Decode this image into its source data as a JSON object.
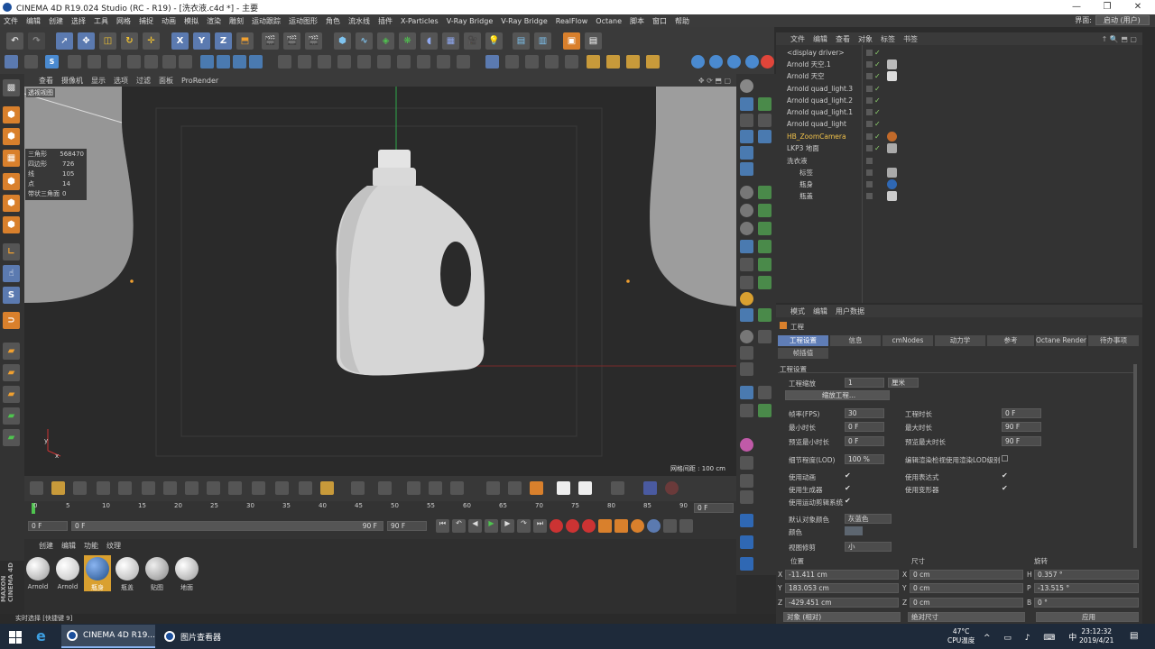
{
  "window": {
    "title": "CINEMA 4D R19.024 Studio (RC - R19) - [洗衣液.c4d *] - 主要"
  },
  "menubar": {
    "items": [
      "文件",
      "编辑",
      "创建",
      "选择",
      "工具",
      "网格",
      "捕捉",
      "动画",
      "模拟",
      "渲染",
      "雕刻",
      "运动跟踪",
      "运动图形",
      "角色",
      "流水线",
      "插件",
      "X-Particles",
      "V-Ray Bridge",
      "V-Ray Bridge",
      "RealFlow",
      "Octane",
      "脚本",
      "窗口",
      "帮助"
    ],
    "layout_label": "界面:",
    "layout_value": "启动 (用户)"
  },
  "viewport": {
    "menu": [
      "查看",
      "摄像机",
      "显示",
      "选项",
      "过滤",
      "面板",
      "ProRender"
    ],
    "name": "透视视图",
    "stats": [
      {
        "k": "三角形",
        "v": "568470"
      },
      {
        "k": "四边形",
        "v": "726"
      },
      {
        "k": "线",
        "v": "105"
      },
      {
        "k": "点",
        "v": "14"
      },
      {
        "k": "带状三角面",
        "v": "0"
      }
    ],
    "grid_label": "网格间距 : 100 cm"
  },
  "object_manager": {
    "menu": [
      "文件",
      "编辑",
      "查看",
      "对象",
      "标签",
      "书签"
    ],
    "objects": [
      {
        "name": "<display driver>",
        "color": "#cfcfcf"
      },
      {
        "name": "Arnold 天空.1",
        "color": "#cfcfcf"
      },
      {
        "name": "Arnold 天空",
        "color": "#cfcfcf"
      },
      {
        "name": "Arnold quad_light.3",
        "color": "#cfcfcf"
      },
      {
        "name": "Arnold quad_light.2",
        "color": "#cfcfcf"
      },
      {
        "name": "Arnold quad_light.1",
        "color": "#cfcfcf"
      },
      {
        "name": "Arnold quad_light",
        "color": "#cfcfcf"
      },
      {
        "name": "HB_ZoomCamera",
        "color": "#f0c14a"
      },
      {
        "name": "LKP3 地面",
        "color": "#cfcfcf"
      },
      {
        "name": "洗衣液",
        "color": "#cfcfcf"
      },
      {
        "name": "标签",
        "color": "#cfcfcf"
      },
      {
        "name": "瓶身",
        "color": "#cfcfcf"
      },
      {
        "name": "瓶盖",
        "color": "#cfcfcf"
      }
    ]
  },
  "attribute_manager": {
    "menu": [
      "模式",
      "编辑",
      "用户数据"
    ],
    "title": "工程",
    "tabs": [
      "工程设置",
      "信息",
      "cmNodes",
      "动力学",
      "参考",
      "Octane Render",
      "待办事项",
      "帧插值"
    ],
    "section": "工程设置",
    "fields": {
      "scale_label": "工程缩放",
      "scale_value": "1",
      "scale_unit": "厘米",
      "scale_button": "缩放工程...",
      "fps_label": "帧率(FPS)",
      "fps_value": "30",
      "project_time_label": "工程时长",
      "project_time_value": "0 F",
      "min_time_label": "最小时长",
      "min_time_value": "0 F",
      "max_time_label": "最大时长",
      "max_time_value": "90 F",
      "preview_min_label": "预览最小时长",
      "preview_min_value": "0 F",
      "preview_max_label": "预览最大时长",
      "preview_max_value": "90 F",
      "lod_label": "细节程度(LOD)",
      "lod_value": "100 %",
      "lod_render_label": "编辑渲染检视使用渲染LOD级别",
      "use_anim": "使用动画",
      "use_expr": "使用表达式",
      "use_gen": "使用生成器",
      "use_deform": "使用变形器",
      "use_motion": "使用运动剪辑系统",
      "default_color_label": "默认对象颜色",
      "default_color_value": "灰蓝色",
      "color_label": "颜色",
      "clip_label": "视图修剪",
      "clip_value": "小"
    }
  },
  "coordinates": {
    "headers": [
      "位置",
      "尺寸",
      "旋转"
    ],
    "rows": [
      {
        "a": "X",
        "av": "-11.411 cm",
        "b": "X",
        "bv": "0 cm",
        "c": "H",
        "cv": "0.357 °"
      },
      {
        "a": "Y",
        "av": "183.053 cm",
        "b": "Y",
        "bv": "0 cm",
        "c": "P",
        "cv": "-13.515 °"
      },
      {
        "a": "Z",
        "av": "-429.451 cm",
        "b": "Z",
        "bv": "0 cm",
        "c": "B",
        "cv": "0 °"
      }
    ],
    "mode1": "对象 (相对)",
    "mode2": "绝对尺寸",
    "apply": "应用"
  },
  "timeline": {
    "ticks": [
      "0",
      "5",
      "10",
      "15",
      "20",
      "25",
      "30",
      "35",
      "40",
      "45",
      "50",
      "55",
      "60",
      "65",
      "70",
      "75",
      "80",
      "85",
      "90"
    ],
    "current": "0 F",
    "start": "0 F",
    "slider_left": "0 F",
    "slider_right": "90 F",
    "end": "90 F"
  },
  "material_manager": {
    "menu": [
      "创建",
      "编辑",
      "功能",
      "纹理"
    ],
    "materials": [
      {
        "name": "Arnold",
        "ball": "#d8d8d8"
      },
      {
        "name": "Arnold",
        "ball": "#efefef"
      },
      {
        "name": "瓶身",
        "ball": "#2f68b4"
      },
      {
        "name": "瓶盖",
        "ball": "#dcdcdc"
      },
      {
        "name": "贴图",
        "ball": "#c8c8c8"
      },
      {
        "name": "地面",
        "ball": "#d4d4d4"
      }
    ]
  },
  "status": {
    "text": "实时选择 [快捷键 9]"
  },
  "brand": {
    "line1": "MAXON",
    "line2": "CINEMA 4D"
  },
  "taskbar": {
    "apps": [
      {
        "label": "CINEMA 4D R19..."
      },
      {
        "label": "图片查看器"
      }
    ],
    "temp": "47°C",
    "temp_label": "CPU温度",
    "time": "23:12:32",
    "date": "2019/4/21"
  }
}
